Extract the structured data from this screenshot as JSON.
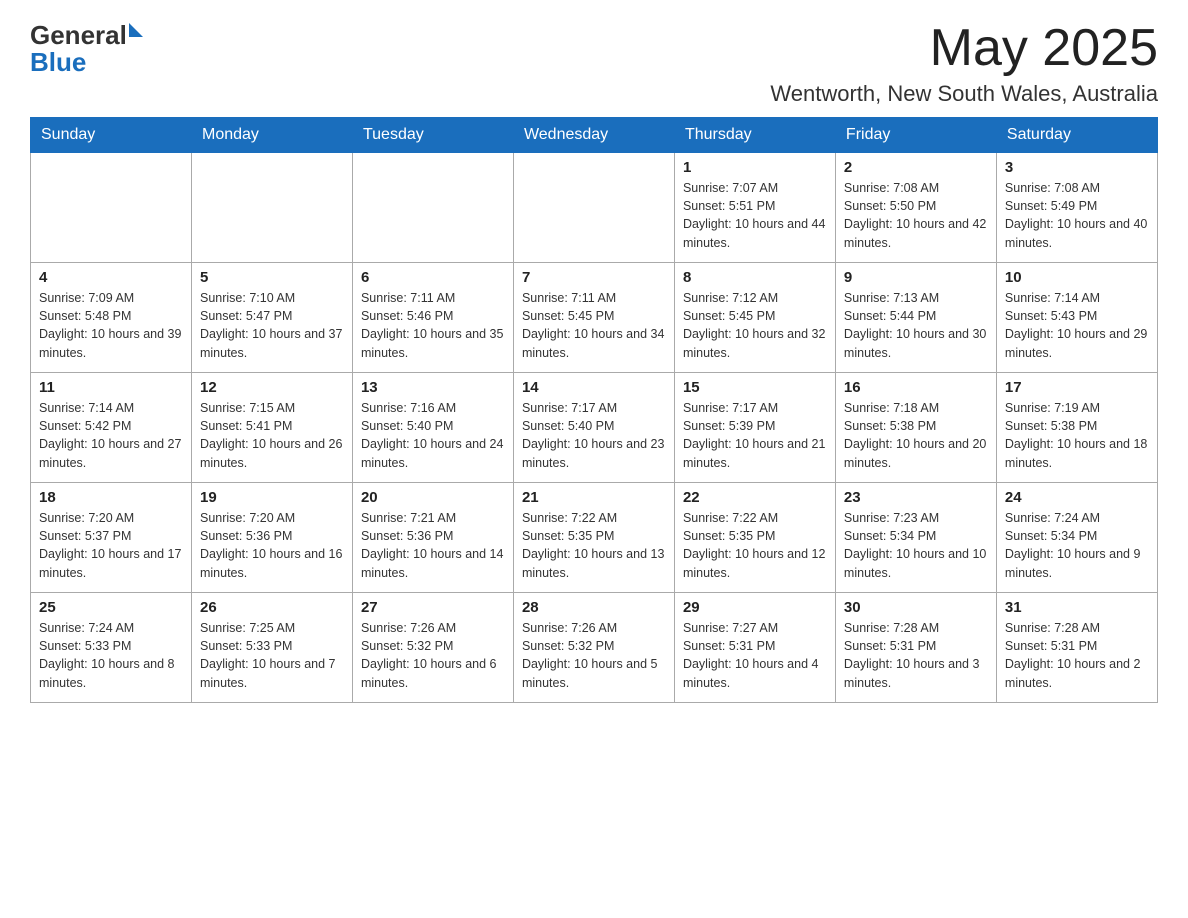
{
  "header": {
    "logo_general": "General",
    "logo_blue": "Blue",
    "month_year": "May 2025",
    "location": "Wentworth, New South Wales, Australia"
  },
  "days_of_week": [
    "Sunday",
    "Monday",
    "Tuesday",
    "Wednesday",
    "Thursday",
    "Friday",
    "Saturday"
  ],
  "weeks": [
    [
      {
        "day": "",
        "info": ""
      },
      {
        "day": "",
        "info": ""
      },
      {
        "day": "",
        "info": ""
      },
      {
        "day": "",
        "info": ""
      },
      {
        "day": "1",
        "info": "Sunrise: 7:07 AM\nSunset: 5:51 PM\nDaylight: 10 hours and 44 minutes."
      },
      {
        "day": "2",
        "info": "Sunrise: 7:08 AM\nSunset: 5:50 PM\nDaylight: 10 hours and 42 minutes."
      },
      {
        "day": "3",
        "info": "Sunrise: 7:08 AM\nSunset: 5:49 PM\nDaylight: 10 hours and 40 minutes."
      }
    ],
    [
      {
        "day": "4",
        "info": "Sunrise: 7:09 AM\nSunset: 5:48 PM\nDaylight: 10 hours and 39 minutes."
      },
      {
        "day": "5",
        "info": "Sunrise: 7:10 AM\nSunset: 5:47 PM\nDaylight: 10 hours and 37 minutes."
      },
      {
        "day": "6",
        "info": "Sunrise: 7:11 AM\nSunset: 5:46 PM\nDaylight: 10 hours and 35 minutes."
      },
      {
        "day": "7",
        "info": "Sunrise: 7:11 AM\nSunset: 5:45 PM\nDaylight: 10 hours and 34 minutes."
      },
      {
        "day": "8",
        "info": "Sunrise: 7:12 AM\nSunset: 5:45 PM\nDaylight: 10 hours and 32 minutes."
      },
      {
        "day": "9",
        "info": "Sunrise: 7:13 AM\nSunset: 5:44 PM\nDaylight: 10 hours and 30 minutes."
      },
      {
        "day": "10",
        "info": "Sunrise: 7:14 AM\nSunset: 5:43 PM\nDaylight: 10 hours and 29 minutes."
      }
    ],
    [
      {
        "day": "11",
        "info": "Sunrise: 7:14 AM\nSunset: 5:42 PM\nDaylight: 10 hours and 27 minutes."
      },
      {
        "day": "12",
        "info": "Sunrise: 7:15 AM\nSunset: 5:41 PM\nDaylight: 10 hours and 26 minutes."
      },
      {
        "day": "13",
        "info": "Sunrise: 7:16 AM\nSunset: 5:40 PM\nDaylight: 10 hours and 24 minutes."
      },
      {
        "day": "14",
        "info": "Sunrise: 7:17 AM\nSunset: 5:40 PM\nDaylight: 10 hours and 23 minutes."
      },
      {
        "day": "15",
        "info": "Sunrise: 7:17 AM\nSunset: 5:39 PM\nDaylight: 10 hours and 21 minutes."
      },
      {
        "day": "16",
        "info": "Sunrise: 7:18 AM\nSunset: 5:38 PM\nDaylight: 10 hours and 20 minutes."
      },
      {
        "day": "17",
        "info": "Sunrise: 7:19 AM\nSunset: 5:38 PM\nDaylight: 10 hours and 18 minutes."
      }
    ],
    [
      {
        "day": "18",
        "info": "Sunrise: 7:20 AM\nSunset: 5:37 PM\nDaylight: 10 hours and 17 minutes."
      },
      {
        "day": "19",
        "info": "Sunrise: 7:20 AM\nSunset: 5:36 PM\nDaylight: 10 hours and 16 minutes."
      },
      {
        "day": "20",
        "info": "Sunrise: 7:21 AM\nSunset: 5:36 PM\nDaylight: 10 hours and 14 minutes."
      },
      {
        "day": "21",
        "info": "Sunrise: 7:22 AM\nSunset: 5:35 PM\nDaylight: 10 hours and 13 minutes."
      },
      {
        "day": "22",
        "info": "Sunrise: 7:22 AM\nSunset: 5:35 PM\nDaylight: 10 hours and 12 minutes."
      },
      {
        "day": "23",
        "info": "Sunrise: 7:23 AM\nSunset: 5:34 PM\nDaylight: 10 hours and 10 minutes."
      },
      {
        "day": "24",
        "info": "Sunrise: 7:24 AM\nSunset: 5:34 PM\nDaylight: 10 hours and 9 minutes."
      }
    ],
    [
      {
        "day": "25",
        "info": "Sunrise: 7:24 AM\nSunset: 5:33 PM\nDaylight: 10 hours and 8 minutes."
      },
      {
        "day": "26",
        "info": "Sunrise: 7:25 AM\nSunset: 5:33 PM\nDaylight: 10 hours and 7 minutes."
      },
      {
        "day": "27",
        "info": "Sunrise: 7:26 AM\nSunset: 5:32 PM\nDaylight: 10 hours and 6 minutes."
      },
      {
        "day": "28",
        "info": "Sunrise: 7:26 AM\nSunset: 5:32 PM\nDaylight: 10 hours and 5 minutes."
      },
      {
        "day": "29",
        "info": "Sunrise: 7:27 AM\nSunset: 5:31 PM\nDaylight: 10 hours and 4 minutes."
      },
      {
        "day": "30",
        "info": "Sunrise: 7:28 AM\nSunset: 5:31 PM\nDaylight: 10 hours and 3 minutes."
      },
      {
        "day": "31",
        "info": "Sunrise: 7:28 AM\nSunset: 5:31 PM\nDaylight: 10 hours and 2 minutes."
      }
    ]
  ]
}
